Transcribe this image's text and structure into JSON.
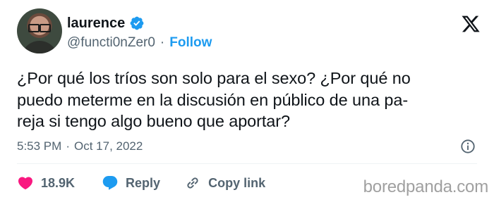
{
  "user": {
    "display_name": "laurence",
    "handle": "@functi0nZer0",
    "separator": "·",
    "follow_label": "Follow"
  },
  "tweet": {
    "text_lines": [
      "¿Por qué los tríos son solo para el sexo? ¿Por qué no",
      "puedo meterme en la discusión en público de una pa-",
      "reja si tengo algo bueno que aportar?"
    ],
    "time": "5:53 PM",
    "separator": "·",
    "date": "Oct 17, 2022"
  },
  "actions": {
    "likes_count": "18.9K",
    "reply_label": "Reply",
    "copy_link_label": "Copy link"
  },
  "watermark": "boredpanda.com",
  "colors": {
    "accent": "#1d9bf0",
    "like": "#f91880",
    "muted": "#536471",
    "text": "#0f1419"
  },
  "icons": {
    "verified": "verified-badge-icon",
    "platform": "x-logo-icon",
    "info": "info-icon",
    "like": "heart-icon",
    "reply": "speech-bubble-icon",
    "copy": "link-icon"
  }
}
